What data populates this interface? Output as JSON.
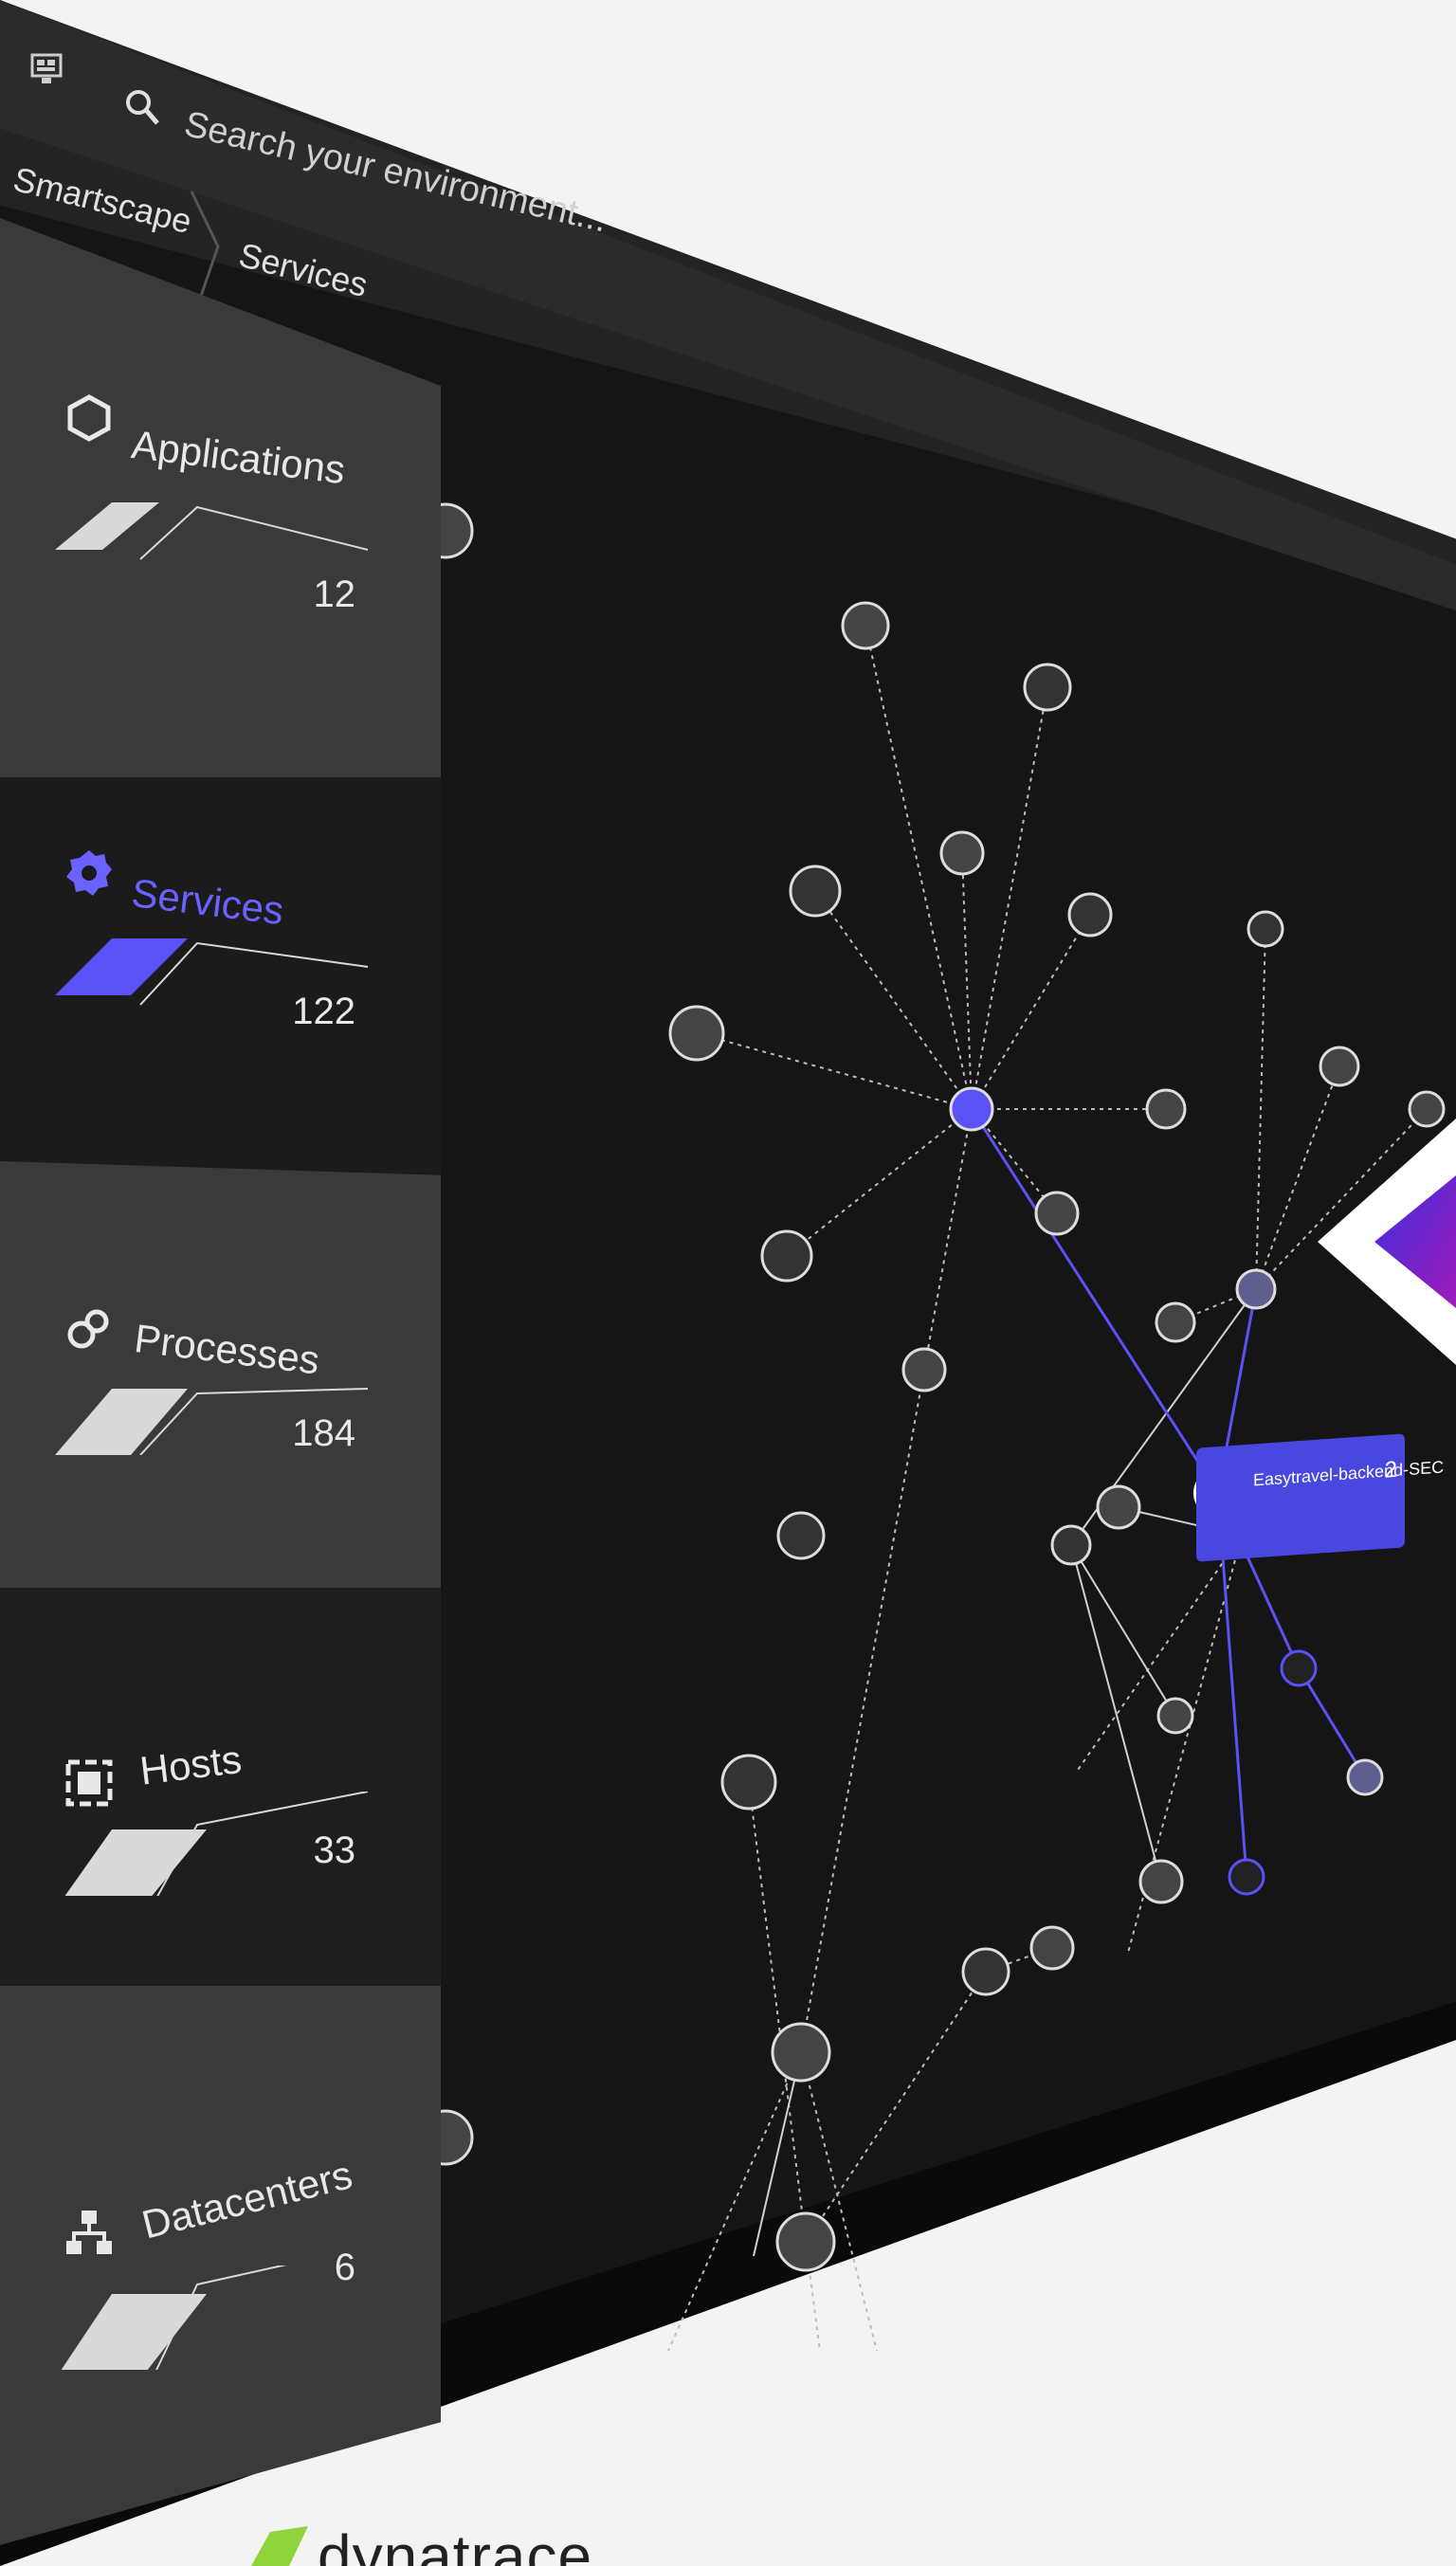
{
  "search": {
    "placeholder": "Search your environment..."
  },
  "breadcrumb": [
    "Smartscape",
    "Services"
  ],
  "categories": [
    {
      "label": "Applications",
      "count": "12",
      "icon": "hexagon-icon",
      "active": false
    },
    {
      "label": "Services",
      "count": "122",
      "icon": "gear-icon",
      "active": true
    },
    {
      "label": "Processes",
      "count": "184",
      "icon": "processes-icon",
      "active": false
    },
    {
      "label": "Hosts",
      "count": "33",
      "icon": "host-icon",
      "active": false
    },
    {
      "label": "Datacenters",
      "count": "6",
      "icon": "datacenter-icon",
      "active": false
    }
  ],
  "tooltip": {
    "title": "Easytravel-backend-SEC",
    "subtitle": "",
    "badge": "2"
  },
  "brand": {
    "name": "dynatrace"
  },
  "colors": {
    "accent": "#6a62ff",
    "panel": "#3a3a3a",
    "background": "#151515"
  }
}
